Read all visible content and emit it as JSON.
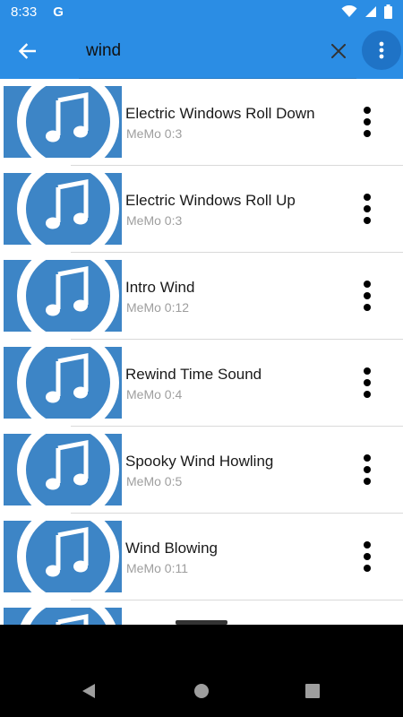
{
  "status_bar": {
    "time": "8:33",
    "google_glyph": "G"
  },
  "search": {
    "value": "wind",
    "placeholder": ""
  },
  "icons": {
    "back": "arrow-left-icon",
    "clear": "close-icon",
    "menu": "more-vert-icon",
    "music": "music-note-icon"
  },
  "colors": {
    "app_bar": "#2b8de4",
    "menu_button": "#1f73c6",
    "thumb": "#3d85c6"
  },
  "results": [
    {
      "title": "Electric Windows Roll Down",
      "subtitle": "MeMo 0:3"
    },
    {
      "title": "Electric Windows Roll Up",
      "subtitle": "MeMo 0:3"
    },
    {
      "title": "Intro Wind",
      "subtitle": "MeMo 0:12"
    },
    {
      "title": "Rewind Time Sound",
      "subtitle": "MeMo 0:4"
    },
    {
      "title": "Spooky Wind Howling",
      "subtitle": "MeMo 0:5"
    },
    {
      "title": "Wind Blowing",
      "subtitle": "MeMo 0:11"
    },
    {
      "title": "",
      "subtitle": ""
    }
  ]
}
